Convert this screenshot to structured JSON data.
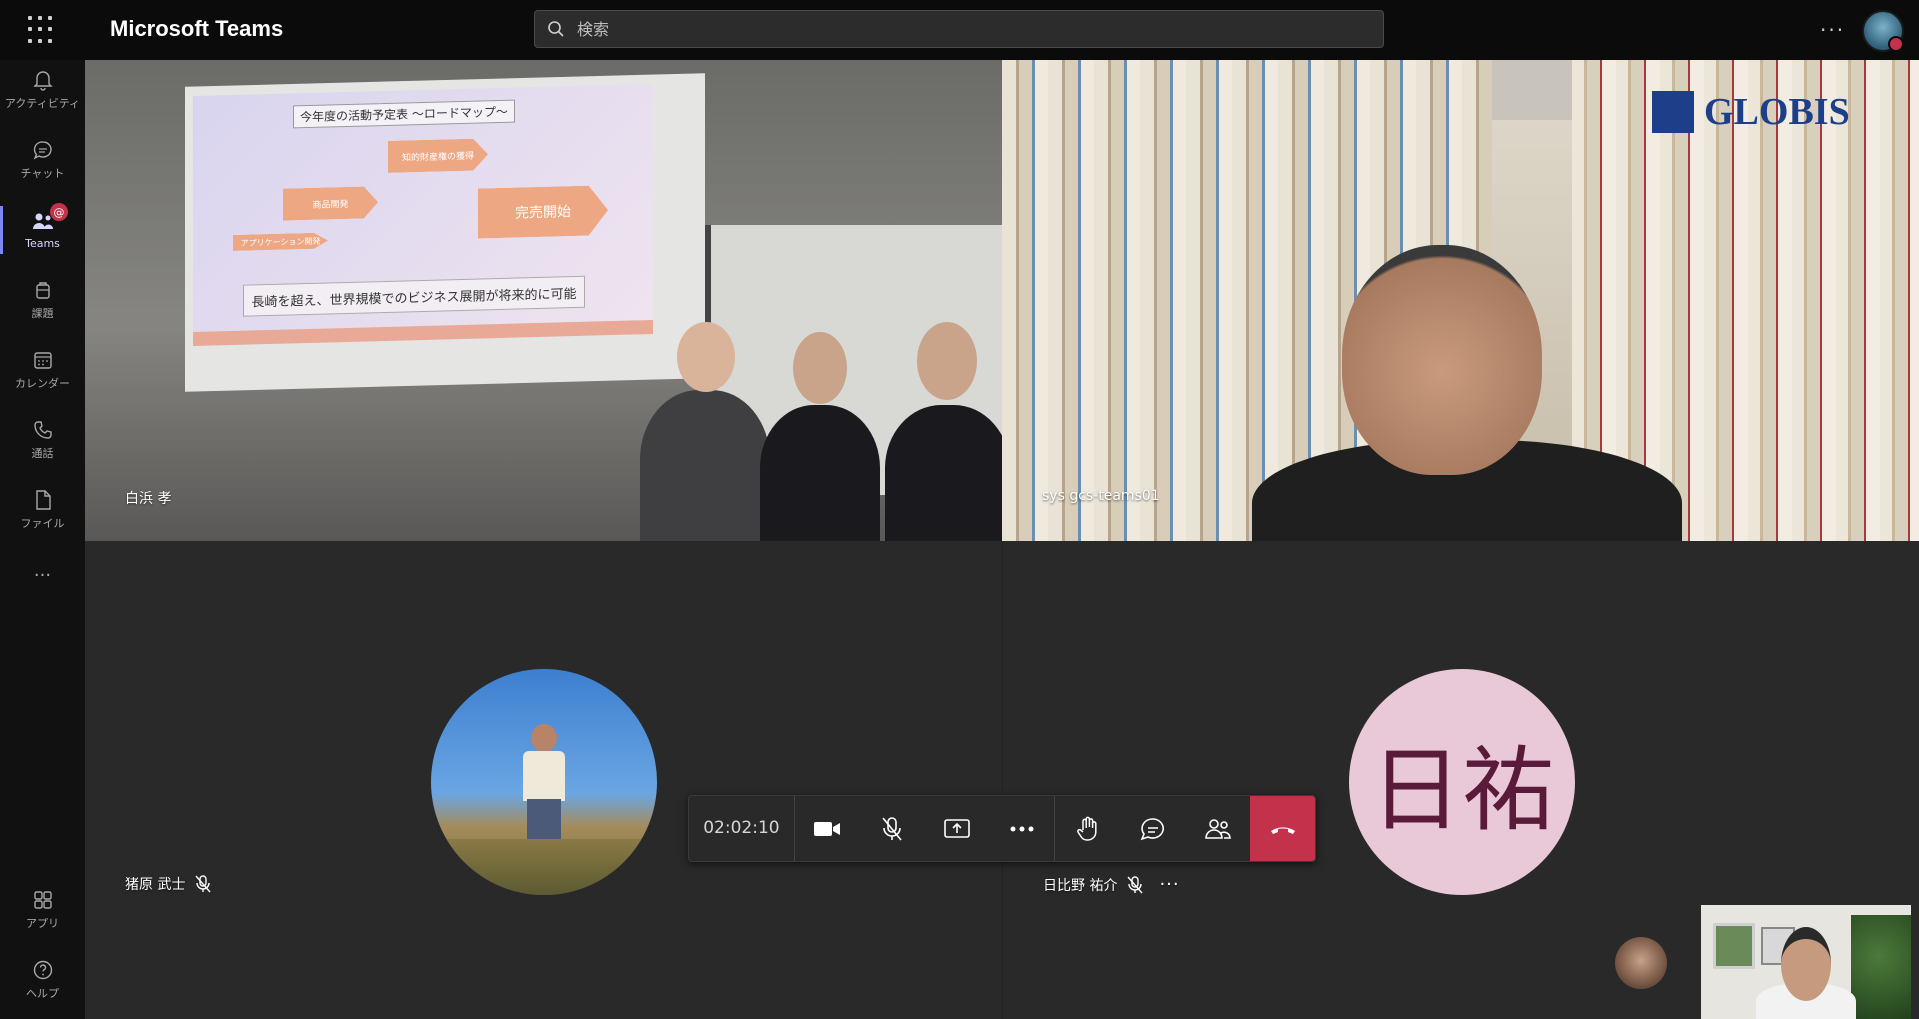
{
  "app": {
    "title": "Microsoft Teams"
  },
  "search": {
    "placeholder": "検索"
  },
  "rail": {
    "items": [
      {
        "label": "アクティビティ",
        "icon": "bell-icon"
      },
      {
        "label": "チャット",
        "icon": "chat-icon"
      },
      {
        "label": "Teams",
        "icon": "teams-icon",
        "badge": "@",
        "active": true
      },
      {
        "label": "課題",
        "icon": "assignments-icon"
      },
      {
        "label": "カレンダー",
        "icon": "calendar-icon"
      },
      {
        "label": "通話",
        "icon": "phone-icon"
      },
      {
        "label": "ファイル",
        "icon": "file-icon"
      },
      {
        "label": "...",
        "icon": "more-icon"
      }
    ],
    "bottom": [
      {
        "label": "アプリ",
        "icon": "apps-icon"
      },
      {
        "label": "ヘルプ",
        "icon": "help-icon"
      }
    ]
  },
  "slide": {
    "title": "今年度の活動予定表 〜ロードマップ〜",
    "footer": "長崎を超え、世界規模でのビジネス展開が将来的に可能",
    "arrows": [
      "商品開発",
      "知的財産権の獲得",
      "完売開始",
      "アプリケーション開発"
    ]
  },
  "globis_logo": "GLOBIS",
  "participants": [
    {
      "name": "白浜 孝"
    },
    {
      "name": "sys gcs-teams01"
    },
    {
      "name": "猪原 武士",
      "muted": true
    },
    {
      "name": "日比野 祐介",
      "muted": true,
      "initials": "日祐"
    }
  ],
  "call": {
    "timer": "02:02:10"
  },
  "colors": {
    "accent": "#7f85f5",
    "hangup": "#c4314b",
    "badge": "#c4314b",
    "initials_bg": "#e9c8d8"
  }
}
